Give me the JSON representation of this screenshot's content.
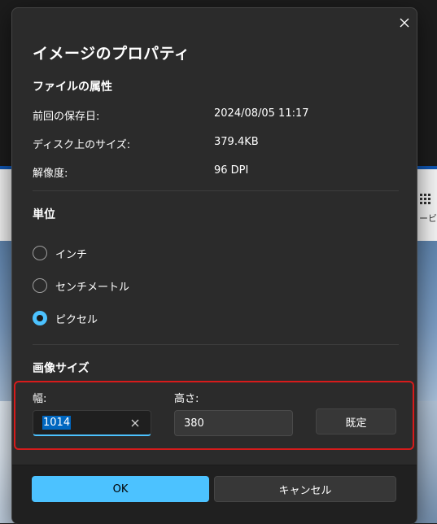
{
  "background": {
    "right_text": "ービ"
  },
  "dialog": {
    "title": "イメージのプロパティ",
    "file_attributes": {
      "heading": "ファイルの属性",
      "rows": [
        {
          "label": "前回の保存日:",
          "value": "2024/08/05 11:17"
        },
        {
          "label": "ディスク上のサイズ:",
          "value": "379.4KB"
        },
        {
          "label": "解像度:",
          "value": "96 DPI"
        }
      ]
    },
    "units": {
      "heading": "単位",
      "options": [
        {
          "label": "インチ",
          "checked": false
        },
        {
          "label": "センチメートル",
          "checked": false
        },
        {
          "label": "ピクセル",
          "checked": true
        }
      ]
    },
    "image_size": {
      "heading": "画像サイズ",
      "width_label": "幅:",
      "width_value": "1014",
      "height_label": "高さ:",
      "height_value": "380",
      "default_button": "既定"
    },
    "footer": {
      "ok_label": "OK",
      "cancel_label": "キャンセル"
    }
  },
  "colors": {
    "accent": "#4cc2ff",
    "highlight_border": "#d71b1b",
    "dialog_bg": "#2b2b2b"
  }
}
